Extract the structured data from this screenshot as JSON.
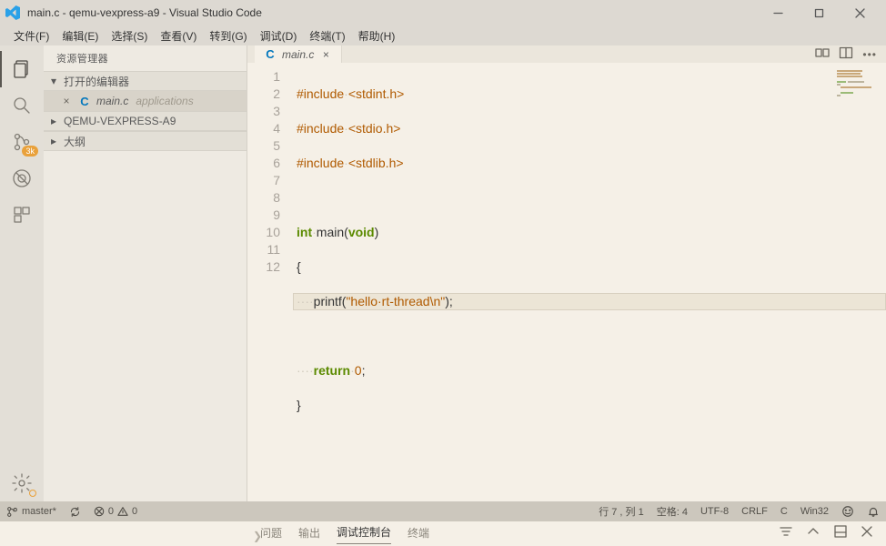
{
  "title": "main.c - qemu-vexpress-a9 - Visual Studio Code",
  "menu": [
    "文件(F)",
    "编辑(E)",
    "选择(S)",
    "查看(V)",
    "转到(G)",
    "调试(D)",
    "终端(T)",
    "帮助(H)"
  ],
  "sidebar": {
    "title": "资源管理器",
    "openEditorsLabel": "打开的编辑器",
    "openFile": {
      "name": "main.c",
      "path": "applications"
    },
    "folderLabel": "QEMU-VEXPRESS-A9",
    "outlineLabel": "大纲"
  },
  "scmBadge": "3k",
  "tab": {
    "name": "main.c"
  },
  "code": {
    "lines": [
      1,
      2,
      3,
      4,
      5,
      6,
      7,
      8,
      9,
      10,
      11,
      12
    ],
    "ws": "····",
    "l1_pp": "#include",
    "l1_sp": "·",
    "l1_inc": "<stdint.h>",
    "l2_pp": "#include",
    "l2_sp": "·",
    "l2_inc": "<stdio.h>",
    "l3_pp": "#include",
    "l3_sp": "·",
    "l3_inc": "<stdlib.h>",
    "l5_kw": "int",
    "l5_sp": "·",
    "l5_fn": "main",
    "l5_p": "(",
    "l5_vd": "void",
    "l5_p2": ")",
    "l6": "{",
    "l7_fn": "printf",
    "l7_p": "(",
    "l7_s1": "\"hello·rt-thread",
    "l7_esc": "\\n",
    "l7_s2": "\"",
    "l7_p2": ");",
    "l9_kw": "return",
    "l9_sp": "·",
    "l9_n": "0",
    "l9_sc": ";",
    "l10": "}"
  },
  "panel": {
    "tabs": [
      "问题",
      "输出",
      "调试控制台",
      "终端"
    ],
    "active": 2
  },
  "status": {
    "branch": "master*",
    "errors": "0",
    "warnings": "0",
    "pos": "行 7 , 列 1",
    "spaces": "空格: 4",
    "enc": "UTF-8",
    "eol": "CRLF",
    "lang": "C",
    "os": "Win32"
  }
}
